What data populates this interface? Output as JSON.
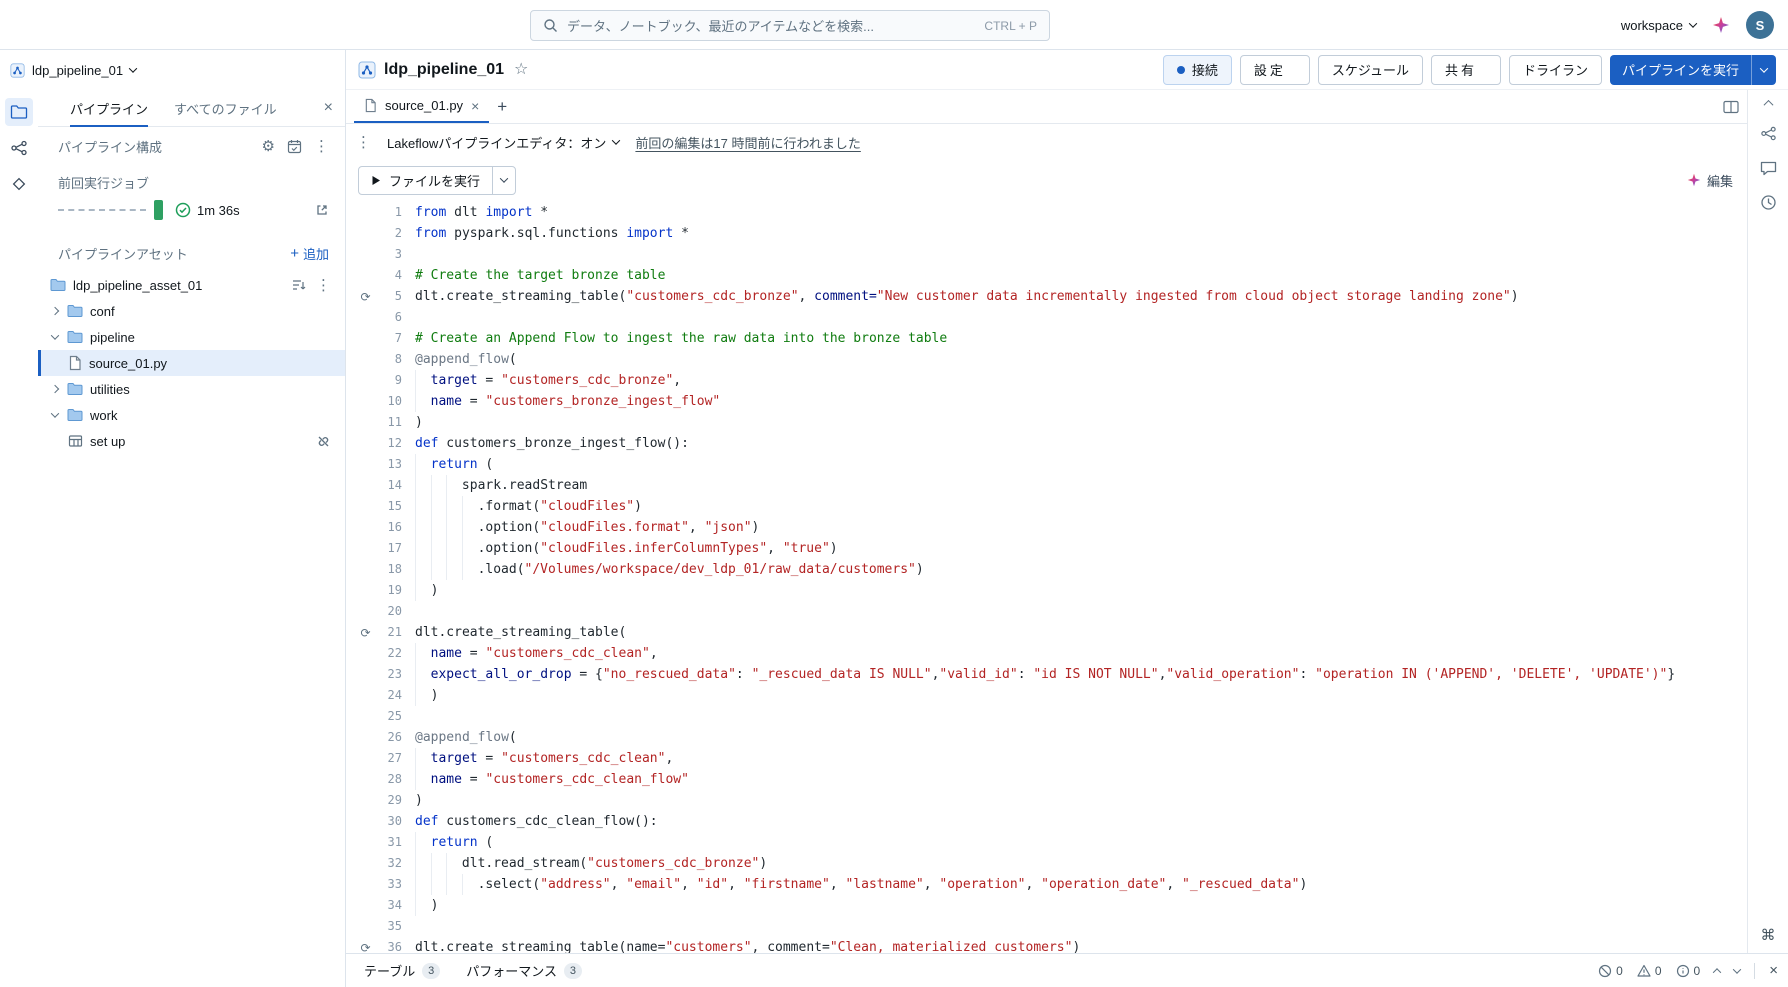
{
  "colors": {
    "primary": "#1b5fc2",
    "success": "#2ea062",
    "selection_bg": "#e4eefb",
    "string": "#b32424",
    "keyword": "#0433c9",
    "comment": "#107c10"
  },
  "topbar": {
    "search_placeholder": "データ、ノートブック、最近のアイテムなどを検索...",
    "search_shortcut": "CTRL + P",
    "workspace_label": "workspace",
    "avatar_initial": "S"
  },
  "header": {
    "title": "ldp_pipeline_01",
    "buttons": {
      "connect": "接続",
      "settings": "設定",
      "schedule": "スケジュール",
      "share": "共有",
      "dry_run": "ドライラン",
      "run_pipeline": "パイプラインを実行"
    }
  },
  "sidebar": {
    "pipeline_selector": "ldp_pipeline_01",
    "tabs": [
      {
        "label": "パイプライン"
      },
      {
        "label": "すべてのファイル"
      }
    ],
    "config_label": "パイプライン構成",
    "last_run_label": "前回実行ジョブ",
    "last_run_duration": "1m 36s",
    "assets_label": "パイプラインアセット",
    "add_label": "追加",
    "tree": [
      {
        "label": "ldp_pipeline_asset_01"
      },
      {
        "label": "conf"
      },
      {
        "label": "pipeline"
      },
      {
        "label": "source_01.py"
      },
      {
        "label": "utilities"
      },
      {
        "label": "work"
      },
      {
        "label": "set up"
      }
    ]
  },
  "editor": {
    "tab_label": "source_01.py",
    "mode_label": "Lakeflowパイプラインエディタ：オン",
    "last_edit_label": "前回の編集は17 時間前に行われました",
    "run_file_label": "ファイルを実行",
    "edit_label": "編集"
  },
  "bottombar": {
    "tabs": [
      {
        "label": "テーブル",
        "count": "3"
      },
      {
        "label": "パフォーマンス",
        "count": "3"
      }
    ],
    "counters": [
      {
        "name": "errors",
        "value": "0"
      },
      {
        "name": "warnings",
        "value": "0"
      },
      {
        "name": "info",
        "value": "0"
      }
    ]
  },
  "code": {
    "stream_icon_lines": [
      5,
      21,
      36
    ],
    "lines": [
      {
        "i": 0,
        "t": [
          [
            "k",
            "from"
          ],
          [
            "p",
            " dlt "
          ],
          [
            "k",
            "import"
          ],
          [
            "p",
            " *"
          ]
        ]
      },
      {
        "i": 0,
        "t": [
          [
            "k",
            "from"
          ],
          [
            "p",
            " pyspark.sql.functions "
          ],
          [
            "k",
            "import"
          ],
          [
            "p",
            " *"
          ]
        ]
      },
      {
        "i": 0,
        "t": []
      },
      {
        "i": 0,
        "t": [
          [
            "c",
            "# Create the target bronze table"
          ]
        ]
      },
      {
        "i": 0,
        "t": [
          [
            "p",
            "dlt.create_streaming_table("
          ],
          [
            "s",
            "\"customers_cdc_bronze\""
          ],
          [
            "p",
            ", "
          ],
          [
            "v",
            "comment="
          ],
          [
            "s",
            "\"New customer data incrementally ingested from cloud object storage landing zone\""
          ],
          [
            "p",
            ")"
          ]
        ]
      },
      {
        "i": 0,
        "t": []
      },
      {
        "i": 0,
        "t": [
          [
            "c",
            "# Create an Append Flow to ingest the raw data into the bronze table"
          ]
        ]
      },
      {
        "i": 0,
        "t": [
          [
            "d",
            "@append_flow"
          ],
          [
            "p",
            "("
          ]
        ]
      },
      {
        "i": 2,
        "t": [
          [
            "v",
            "target"
          ],
          [
            "p",
            " = "
          ],
          [
            "s",
            "\"customers_cdc_bronze\""
          ],
          [
            "p",
            ","
          ]
        ]
      },
      {
        "i": 2,
        "t": [
          [
            "v",
            "name"
          ],
          [
            "p",
            " = "
          ],
          [
            "s",
            "\"customers_bronze_ingest_flow\""
          ]
        ]
      },
      {
        "i": 0,
        "t": [
          [
            "p",
            ")"
          ]
        ]
      },
      {
        "i": 0,
        "t": [
          [
            "k",
            "def"
          ],
          [
            "p",
            " customers_bronze_ingest_flow():"
          ]
        ]
      },
      {
        "i": 2,
        "t": [
          [
            "k",
            "return"
          ],
          [
            "p",
            " ("
          ]
        ]
      },
      {
        "i": 6,
        "t": [
          [
            "p",
            "spark.readStream"
          ]
        ]
      },
      {
        "i": 8,
        "t": [
          [
            "p",
            ".format("
          ],
          [
            "s",
            "\"cloudFiles\""
          ],
          [
            "p",
            ")"
          ]
        ]
      },
      {
        "i": 8,
        "t": [
          [
            "p",
            ".option("
          ],
          [
            "s",
            "\"cloudFiles.format\""
          ],
          [
            "p",
            ", "
          ],
          [
            "s",
            "\"json\""
          ],
          [
            "p",
            ")"
          ]
        ]
      },
      {
        "i": 8,
        "t": [
          [
            "p",
            ".option("
          ],
          [
            "s",
            "\"cloudFiles.inferColumnTypes\""
          ],
          [
            "p",
            ", "
          ],
          [
            "s",
            "\"true\""
          ],
          [
            "p",
            ")"
          ]
        ]
      },
      {
        "i": 8,
        "t": [
          [
            "p",
            ".load("
          ],
          [
            "s",
            "\"/Volumes/workspace/dev_ldp_01/raw_data/customers\""
          ],
          [
            "p",
            ")"
          ]
        ]
      },
      {
        "i": 2,
        "t": [
          [
            "p",
            ")"
          ]
        ]
      },
      {
        "i": 0,
        "t": []
      },
      {
        "i": 0,
        "t": [
          [
            "p",
            "dlt.create_streaming_table("
          ]
        ]
      },
      {
        "i": 2,
        "t": [
          [
            "v",
            "name"
          ],
          [
            "p",
            " = "
          ],
          [
            "s",
            "\"customers_cdc_clean\""
          ],
          [
            "p",
            ","
          ]
        ]
      },
      {
        "i": 2,
        "t": [
          [
            "v",
            "expect_all_or_drop"
          ],
          [
            "p",
            " = {"
          ],
          [
            "s",
            "\"no_rescued_data\""
          ],
          [
            "p",
            ": "
          ],
          [
            "s",
            "\"_rescued_data IS NULL\""
          ],
          [
            "p",
            ","
          ],
          [
            "s",
            "\"valid_id\""
          ],
          [
            "p",
            ": "
          ],
          [
            "s",
            "\"id IS NOT NULL\""
          ],
          [
            "p",
            ","
          ],
          [
            "s",
            "\"valid_operation\""
          ],
          [
            "p",
            ": "
          ],
          [
            "s",
            "\"operation IN ('APPEND', 'DELETE', 'UPDATE')\""
          ],
          [
            "p",
            "}"
          ]
        ]
      },
      {
        "i": 2,
        "t": [
          [
            "p",
            ")"
          ]
        ]
      },
      {
        "i": 0,
        "t": []
      },
      {
        "i": 0,
        "t": [
          [
            "d",
            "@append_flow"
          ],
          [
            "p",
            "("
          ]
        ]
      },
      {
        "i": 2,
        "t": [
          [
            "v",
            "target"
          ],
          [
            "p",
            " = "
          ],
          [
            "s",
            "\"customers_cdc_clean\""
          ],
          [
            "p",
            ","
          ]
        ]
      },
      {
        "i": 2,
        "t": [
          [
            "v",
            "name"
          ],
          [
            "p",
            " = "
          ],
          [
            "s",
            "\"customers_cdc_clean_flow\""
          ]
        ]
      },
      {
        "i": 0,
        "t": [
          [
            "p",
            ")"
          ]
        ]
      },
      {
        "i": 0,
        "t": [
          [
            "k",
            "def"
          ],
          [
            "p",
            " customers_cdc_clean_flow():"
          ]
        ]
      },
      {
        "i": 2,
        "t": [
          [
            "k",
            "return"
          ],
          [
            "p",
            " ("
          ]
        ]
      },
      {
        "i": 6,
        "t": [
          [
            "p",
            "dlt.read_stream("
          ],
          [
            "s",
            "\"customers_cdc_bronze\""
          ],
          [
            "p",
            ")"
          ]
        ]
      },
      {
        "i": 8,
        "t": [
          [
            "p",
            ".select("
          ],
          [
            "s",
            "\"address\""
          ],
          [
            "p",
            ", "
          ],
          [
            "s",
            "\"email\""
          ],
          [
            "p",
            ", "
          ],
          [
            "s",
            "\"id\""
          ],
          [
            "p",
            ", "
          ],
          [
            "s",
            "\"firstname\""
          ],
          [
            "p",
            ", "
          ],
          [
            "s",
            "\"lastname\""
          ],
          [
            "p",
            ", "
          ],
          [
            "s",
            "\"operation\""
          ],
          [
            "p",
            ", "
          ],
          [
            "s",
            "\"operation_date\""
          ],
          [
            "p",
            ", "
          ],
          [
            "s",
            "\"_rescued_data\""
          ],
          [
            "p",
            ")"
          ]
        ]
      },
      {
        "i": 2,
        "t": [
          [
            "p",
            ")"
          ]
        ]
      },
      {
        "i": 0,
        "t": []
      },
      {
        "i": 0,
        "t": [
          [
            "p",
            "dlt.create_streaming_table(name="
          ],
          [
            "s",
            "\"customers\""
          ],
          [
            "p",
            ", comment="
          ],
          [
            "s",
            "\"Clean, materialized customers\""
          ],
          [
            "p",
            ")"
          ]
        ]
      }
    ]
  }
}
